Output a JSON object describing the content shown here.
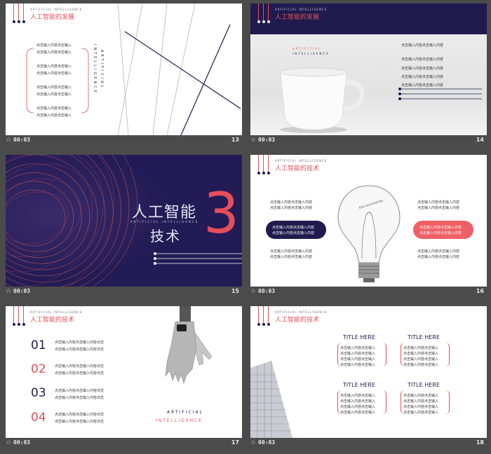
{
  "slides": [
    {
      "time": "00:03",
      "number": "13",
      "header": {
        "en": "ARTIFICIAL INTELLIGENCE",
        "cn": "人工智能的发展"
      },
      "placeholders": [
        "点击输入内容点击输入",
        "点击输入内容点击输入",
        "点击输入内容点击输入",
        "点击输入内容点击输入",
        "点击输入内容点击输入",
        "点击输入内容点击输入",
        "点击输入内容点击输入",
        "点击输入内容点击输入"
      ],
      "vertical_a": "INTELLIGENCE",
      "vertical_b": "ARTIFICIAL"
    },
    {
      "time": "00:03",
      "number": "14",
      "header": {
        "en": "ARTIFICIAL INTELLIGENCE",
        "cn": "人工智能的发展"
      },
      "caption_en_a": "ARTIFICIAL",
      "caption_en_b": "INTELLIGENCE",
      "placeholders": [
        "点击输入内容点击输入内容",
        "点击输入内容点击输入内容",
        "点击输入内容点击输入内容",
        "点击输入内容点击输入内容",
        "点击输入内容点击输入内容"
      ]
    },
    {
      "time": "00:03",
      "number": "15",
      "title_cn": "人工智能",
      "subtitle_en": "ARTIFICIAL INTELLIGENCE",
      "title_cn_2": "技术",
      "big_number": "3"
    },
    {
      "time": "00:03",
      "number": "16",
      "header": {
        "en": "ARTIFICIAL INTELLIGENCE",
        "cn": "人工智能的技术"
      },
      "left_items": [
        "点击输入内容点击输入内容",
        "点击输入内容点击输入内容",
        "点击输入内容点击输入内容",
        "点击输入内容点击输入内容",
        "点击输入内容点击输入内容",
        "点击输入内容点击输入内容"
      ],
      "right_items": [
        "点击输入内容点击输入内容",
        "点击输入内容点击输入内容",
        "点击输入内容点击输入内容",
        "点击输入内容点击输入内容",
        "点击输入内容点击输入内容",
        "点击输入内容点击输入内容"
      ],
      "bulb_text": "the luminaires"
    },
    {
      "time": "00:03",
      "number": "17",
      "header": {
        "en": "ARTIFICIAL INTELLIGENCE",
        "cn": "人工智能的技术"
      },
      "list": [
        {
          "num": "01",
          "lines": [
            "点击输入内容点击输入内容点击",
            "点击输入内容点击输入内容点击"
          ]
        },
        {
          "num": "02",
          "lines": [
            "点击输入内容点击输入内容点击",
            "点击输入内容点击输入内容点击"
          ]
        },
        {
          "num": "03",
          "lines": [
            "点击输入内容点击输入内容点击",
            "点击输入内容点击输入内容点击"
          ]
        },
        {
          "num": "04",
          "lines": [
            "点击输入内容点击输入内容点击",
            "点击输入内容点击输入内容点击"
          ]
        }
      ],
      "caption_en_a": "ARTIFICIAL",
      "caption_en_b": "INTELLIGENCE"
    },
    {
      "time": "00:03",
      "number": "18",
      "header": {
        "en": "ARTIFICIAL INTELLIGENCE",
        "cn": "人工智能的技术"
      },
      "cards": [
        {
          "title": "TITLE HERE",
          "lines": [
            "点击输入内容点击输入",
            "点击输入内容点击输入",
            "点击输入内容点击输入",
            "点击输入内容点击输入"
          ]
        },
        {
          "title": "TITLE HERE",
          "lines": [
            "点击输入内容点击输入",
            "点击输入内容点击输入",
            "点击输入内容点击输入",
            "点击输入内容点击输入"
          ]
        },
        {
          "title": "TITLE HERE",
          "lines": [
            "点击输入内容点击输入",
            "点击输入内容点击输入",
            "点击输入内容点击输入",
            "点击输入内容点击输入"
          ]
        },
        {
          "title": "TITLE HERE",
          "lines": [
            "点击输入内容点击输入",
            "点击输入内容点击输入",
            "点击输入内容点击输入",
            "点击输入内容点击输入"
          ]
        }
      ]
    }
  ],
  "colors": {
    "navy": "#1f1b4e",
    "accent": "#e64f5a",
    "background": "#4b4b4b"
  },
  "icons": {
    "transition": "star-icon"
  }
}
